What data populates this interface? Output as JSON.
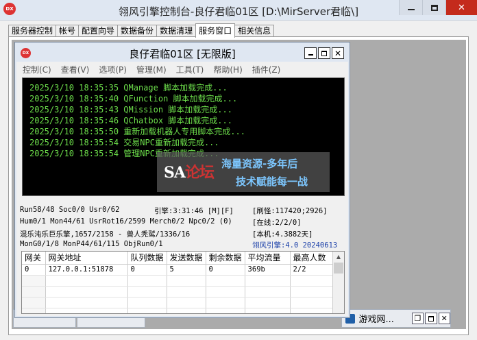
{
  "window": {
    "title": "翎风引擎控制台-良仔君临01区 [D:\\MirServer君临\\]",
    "minimize_glyph": "—",
    "maximize_glyph": "☐",
    "close_glyph": "✕"
  },
  "tabs": [
    "服务器控制",
    "帐号",
    "配置向导",
    "数据备份",
    "数据清理",
    "服务窗口",
    "相关信息"
  ],
  "active_tab": 5,
  "inner_window": {
    "icon_text": "DX",
    "title": "良仔君临01区 [无限版]",
    "close_glyph": "✕"
  },
  "menu": [
    "控制(C)",
    "查看(V)",
    "选项(P)",
    "管理(M)",
    "工具(T)",
    "帮助(H)",
    "插件(Z)"
  ],
  "log": [
    "2025/3/10 18:35:35 QManage 脚本加载完成...",
    "2025/3/10 18:35:40 QFunction 脚本加载完成...",
    "2025/3/10 18:35:43 QMission 脚本加载完成...",
    "2025/3/10 18:35:46 QChatbox 脚本加载完成...",
    "2025/3/10 18:35:50 重新加载机器人专用脚本完成...",
    "2025/3/10 18:35:54 交易NPC重新加载完成...",
    "2025/3/10 18:35:54 管理NPC重新加载完成..."
  ],
  "watermark": {
    "logo_a": "SA",
    "logo_b": "论坛",
    "line1": "海量资源-多年后",
    "line2": "技术赋能每一战"
  },
  "stats": {
    "row1_left": "Run58/48 Soc0/0 Usr0/62",
    "row1_mid": "引擎:3:31:46 [M][F]",
    "row1_right": "[刷怪:117420;2926]",
    "row2_left": "Hum0/1 Mon44/61 UsrRot16/2599 Merch0/2 Npc0/2 (0)",
    "row2_right": "[在线:2/2/0]",
    "row3_left": "混乐沌乐巨乐擎,1657/2158 - 兽人秃鹫/1336/16",
    "row3_right": "[本机:4.3882天]",
    "row4_left": "MonG0/1/8 MonP44/61/115 ObjRun0/1",
    "row4_right": "翎风引擎:4.0 20240613"
  },
  "table": {
    "headers": [
      "网关",
      "网关地址",
      "队列数据",
      "发送数据",
      "剩余数据",
      "平均流量",
      "最高人数"
    ],
    "rows": [
      [
        "0",
        "127.0.0.1:51878",
        "0",
        "5",
        "0",
        "369b",
        "2/2"
      ]
    ],
    "scroll_up_glyph": "▲"
  },
  "minimized": {
    "window3_title": "游戏网..."
  },
  "colors": {
    "console_bg": "#000000",
    "console_text": "#6ddf4b",
    "version_text": "#1a3fa8",
    "title_bar": "#dfe7f2",
    "close_red": "#c42b1c"
  }
}
